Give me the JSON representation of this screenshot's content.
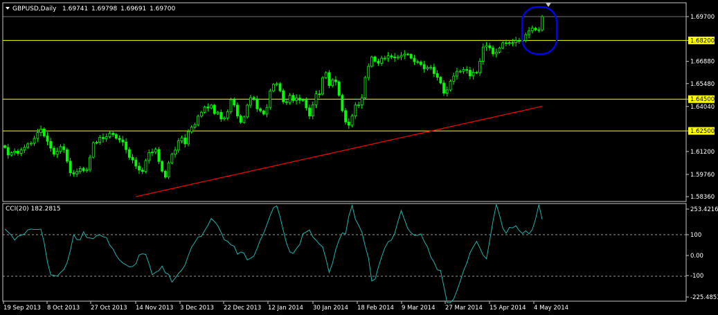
{
  "header": {
    "symbol": "GBPUSD,Daily",
    "open": "1.69741",
    "high": "1.69798",
    "low": "1.69691",
    "close": "1.69700"
  },
  "indicator": {
    "label": "CCI(20) 182.2815"
  },
  "colors": {
    "background": "#000000",
    "frame": "#c8c8c8",
    "candle": "#00ff00",
    "level": "#ffff00",
    "ma": "#ff0000",
    "cci": "#20b2aa",
    "circle": "#0000ff",
    "price_box": "#ffff00"
  },
  "chart_data": [
    {
      "type": "candlestick",
      "title": "GBPUSD,Daily",
      "ylim": [
        1.5836,
        1.6988
      ],
      "x_tick_labels": [
        "19 Sep 2013",
        "8 Oct 2013",
        "27 Oct 2013",
        "14 Nov 2013",
        "3 Dec 2013",
        "22 Dec 2013",
        "12 Jan 2014",
        "30 Jan 2014",
        "18 Feb 2014",
        "9 Mar 2014",
        "27 Mar 2014",
        "15 Apr 2014",
        "4 May 2014"
      ],
      "y_tick_labels": [
        "1.69700",
        "1.68200",
        "1.66880",
        "1.65480",
        "1.64500",
        "1.64040",
        "1.62500",
        "1.61200",
        "1.59760",
        "1.58360"
      ],
      "highlighted_levels": [
        1.682,
        1.645,
        1.625
      ],
      "current_price": 1.697,
      "moving_average": {
        "start": 1.5836,
        "end": 1.6405
      },
      "candles": {
        "count": 165,
        "closes": [
          1.6145,
          1.6098,
          1.6112,
          1.6122,
          1.6108,
          1.613,
          1.6146,
          1.6168,
          1.6172,
          1.6203,
          1.6239,
          1.6262,
          1.6218,
          1.6184,
          1.6141,
          1.6103,
          1.6121,
          1.6151,
          1.6131,
          1.6059,
          1.5986,
          1.5979,
          1.5994,
          1.6013,
          1.6,
          1.6006,
          1.6084,
          1.6176,
          1.6178,
          1.6209,
          1.6201,
          1.6214,
          1.6235,
          1.6227,
          1.6204,
          1.6193,
          1.618,
          1.6132,
          1.6083,
          1.6067,
          1.6028,
          1.6003,
          1.5994,
          1.6063,
          1.6113,
          1.6117,
          1.6133,
          1.6057,
          1.5996,
          1.5959,
          1.6049,
          1.6103,
          1.6129,
          1.6187,
          1.6206,
          1.6168,
          1.6245,
          1.6274,
          1.6289,
          1.6343,
          1.6367,
          1.6401,
          1.6394,
          1.6412,
          1.6359,
          1.6367,
          1.6325,
          1.6331,
          1.6371,
          1.6446,
          1.6413,
          1.6344,
          1.6304,
          1.6338,
          1.6412,
          1.646,
          1.6452,
          1.6389,
          1.6376,
          1.6356,
          1.6398,
          1.6502,
          1.6543,
          1.6547,
          1.6503,
          1.6433,
          1.6429,
          1.6474,
          1.6441,
          1.6457,
          1.6443,
          1.6444,
          1.6395,
          1.6344,
          1.6414,
          1.6483,
          1.6482,
          1.6585,
          1.6617,
          1.6535,
          1.6571,
          1.6559,
          1.6474,
          1.6378,
          1.6306,
          1.6286,
          1.6344,
          1.6413,
          1.6414,
          1.6458,
          1.6586,
          1.6657,
          1.6716,
          1.6689,
          1.6676,
          1.6708,
          1.6708,
          1.6723,
          1.6716,
          1.671,
          1.6717,
          1.6726,
          1.6734,
          1.6732,
          1.6708,
          1.6686,
          1.6684,
          1.6668,
          1.6641,
          1.665,
          1.6651,
          1.6611,
          1.6588,
          1.6552,
          1.6488,
          1.6508,
          1.6563,
          1.6595,
          1.6625,
          1.6625,
          1.6637,
          1.6632,
          1.6596,
          1.6619,
          1.6617,
          1.6689,
          1.6778,
          1.6787,
          1.6773,
          1.6735,
          1.6746,
          1.6773,
          1.6805,
          1.6803,
          1.6806,
          1.6806,
          1.6819,
          1.6816,
          1.682,
          1.6856,
          1.6881,
          1.6897,
          1.6887,
          1.6886,
          1.697
        ]
      }
    },
    {
      "type": "line",
      "title": "CCI(20) 182.2815",
      "ylim": [
        -225.4853,
        253.4216
      ],
      "y_tick_labels": [
        "253.4216",
        "100",
        "0.00",
        "-100",
        "-225.4853"
      ],
      "levels": [
        100,
        -100
      ],
      "values": [
        128,
        113,
        97,
        74,
        92,
        98,
        104,
        123,
        127,
        125,
        125,
        127,
        62,
        -32,
        -93,
        -96,
        -100,
        -82,
        -68,
        -35,
        24,
        100,
        76,
        76,
        114,
        86,
        84,
        81,
        95,
        99,
        90,
        86,
        50,
        32,
        0,
        -22,
        -36,
        -45,
        -55,
        -53,
        -40,
        3,
        8,
        5,
        -40,
        -93,
        -81,
        -73,
        -51,
        -84,
        -91,
        -128,
        -109,
        -86,
        -70,
        -46,
        0,
        40,
        63,
        89,
        92,
        120,
        146,
        178,
        163,
        143,
        111,
        75,
        68,
        51,
        45,
        6,
        17,
        11,
        -22,
        -13,
        -3,
        34,
        76,
        107,
        148,
        193,
        230,
        239,
        186,
        119,
        58,
        17,
        10,
        33,
        53,
        105,
        113,
        123,
        89,
        73,
        55,
        41,
        -15,
        -82,
        -38,
        28,
        74,
        109,
        104,
        190,
        241,
        174,
        145,
        111,
        44,
        -12,
        -123,
        -114,
        -57,
        -7,
        37,
        66,
        74,
        107,
        164,
        216,
        172,
        129,
        109,
        97,
        97,
        104,
        67,
        41,
        -6,
        -33,
        -69,
        -73,
        -148,
        -227,
        -227,
        -210,
        -169,
        -124,
        -75,
        -37,
        13,
        42,
        68,
        36,
        1,
        -16,
        72,
        165,
        246,
        194,
        131,
        107,
        135,
        133,
        143,
        120,
        105,
        119,
        104,
        125,
        175,
        245,
        174
      ]
    }
  ]
}
